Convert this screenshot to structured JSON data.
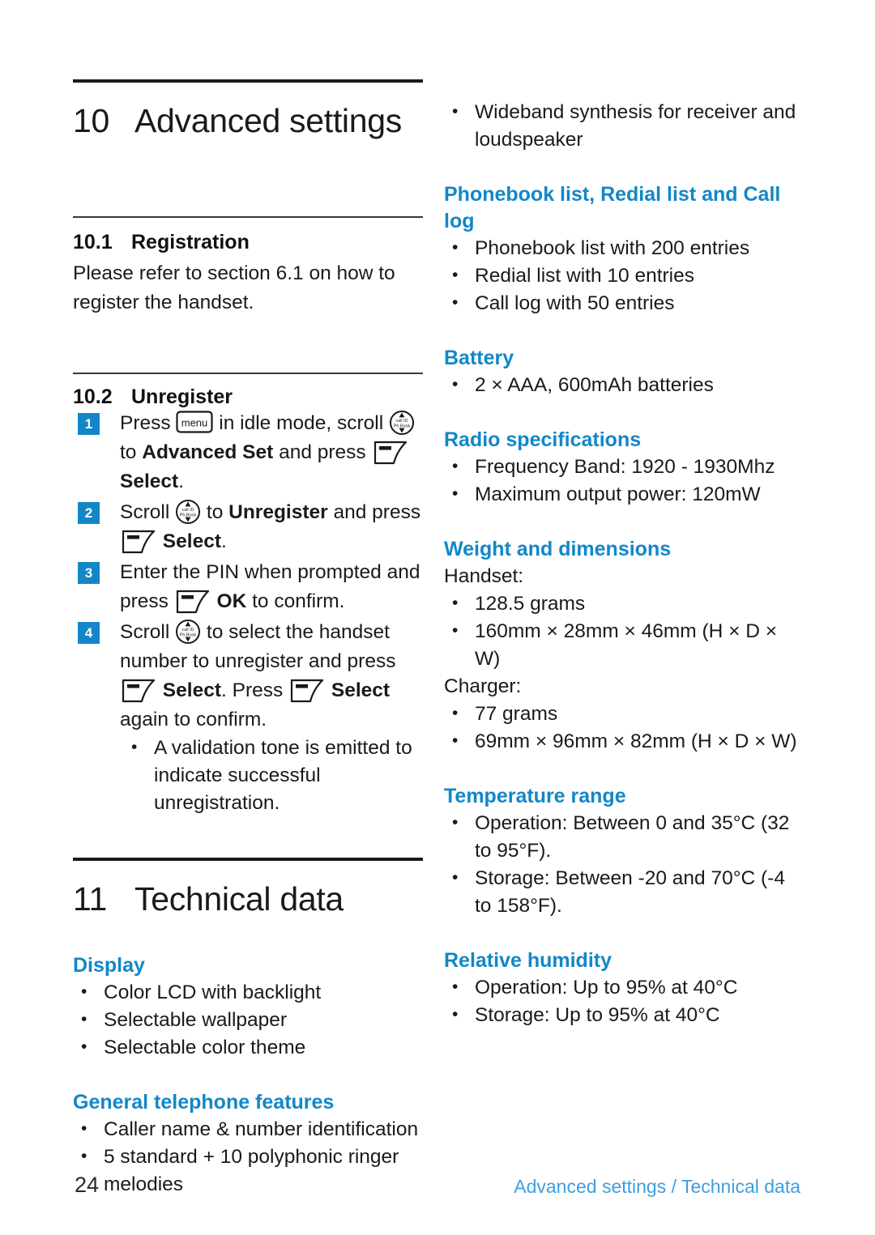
{
  "document": {
    "footer": {
      "page_number": "24",
      "running_title": "Advanced settings / Technical data"
    }
  },
  "left_column": {
    "chapter_10": {
      "number": "10",
      "title": "Advanced settings"
    },
    "section_10_1": {
      "number": "10.1",
      "title": "Registration",
      "body": "Please refer to section 6.1 on how to register the handset."
    },
    "section_10_2": {
      "number": "10.2",
      "title": "Unregister",
      "steps": [
        {
          "index": "1",
          "parts": [
            {
              "type": "text",
              "value": "Press "
            },
            {
              "type": "icon",
              "icon": "menu-key-icon",
              "label": "menu"
            },
            {
              "type": "text",
              "value": " in idle mode, scroll "
            },
            {
              "type": "icon",
              "icon": "navigation-key-icon",
              "label": "call ID / Ph.Book"
            },
            {
              "type": "text",
              "value": " to "
            },
            {
              "type": "bold",
              "value": "Advanced Set"
            },
            {
              "type": "text",
              "value": " and press "
            },
            {
              "type": "icon",
              "icon": "soft-key-icon",
              "label": "soft key"
            },
            {
              "type": "bold",
              "value": " Select"
            },
            {
              "type": "text",
              "value": "."
            }
          ]
        },
        {
          "index": "2",
          "parts": [
            {
              "type": "text",
              "value": "Scroll "
            },
            {
              "type": "icon",
              "icon": "navigation-key-icon",
              "label": "call ID / Ph.Book"
            },
            {
              "type": "text",
              "value": " to "
            },
            {
              "type": "bold",
              "value": "Unregister"
            },
            {
              "type": "text",
              "value": " and press "
            },
            {
              "type": "icon",
              "icon": "soft-key-icon",
              "label": "soft key"
            },
            {
              "type": "bold",
              "value": " Select"
            },
            {
              "type": "text",
              "value": "."
            }
          ]
        },
        {
          "index": "3",
          "parts": [
            {
              "type": "text",
              "value": "Enter the PIN when prompted and press "
            },
            {
              "type": "icon",
              "icon": "soft-key-icon",
              "label": "soft key"
            },
            {
              "type": "bold",
              "value": " OK"
            },
            {
              "type": "text",
              "value": " to confirm."
            }
          ]
        },
        {
          "index": "4",
          "parts": [
            {
              "type": "text",
              "value": "Scroll "
            },
            {
              "type": "icon",
              "icon": "navigation-key-icon",
              "label": "call ID / Ph.Book"
            },
            {
              "type": "text",
              "value": " to select the handset number to unregister and press "
            },
            {
              "type": "icon",
              "icon": "soft-key-icon",
              "label": "soft key"
            },
            {
              "type": "bold",
              "value": " Select"
            },
            {
              "type": "text",
              "value": ". Press "
            },
            {
              "type": "icon",
              "icon": "soft-key-icon",
              "label": "soft key"
            },
            {
              "type": "bold",
              "value": " Select"
            },
            {
              "type": "text",
              "value": " again to confirm."
            }
          ],
          "sub_bullets": [
            "A validation tone is emitted to indicate successful unregistration."
          ]
        }
      ]
    },
    "chapter_11": {
      "number": "11",
      "title": "Technical data"
    },
    "spec_groups": [
      {
        "heading": "Display",
        "bullets": [
          "Color LCD with backlight",
          "Selectable wallpaper",
          "Selectable color theme"
        ]
      },
      {
        "heading": "General telephone features",
        "bullets": [
          "Caller name & number identification",
          "5 standard + 10 polyphonic ringer melodies"
        ]
      }
    ]
  },
  "right_column": {
    "continued_bullets": [
      "Wideband synthesis for receiver and loudspeaker"
    ],
    "spec_groups": [
      {
        "heading": "Phonebook list, Redial list and Call log",
        "bullets": [
          "Phonebook list with 200 entries",
          "Redial list with 10 entries",
          "Call log with 50 entries"
        ]
      },
      {
        "heading": "Battery",
        "bullets": [
          "2 × AAA, 600mAh batteries"
        ]
      },
      {
        "heading": "Radio specifications",
        "bullets": [
          "Frequency Band: 1920 - 1930Mhz",
          "Maximum output power: 120mW"
        ]
      },
      {
        "heading": "Weight and dimensions",
        "subgroups": [
          {
            "label": "Handset:",
            "bullets": [
              "128.5 grams",
              "160mm × 28mm × 46mm (H × D × W)"
            ]
          },
          {
            "label": "Charger:",
            "bullets": [
              "77 grams",
              "69mm × 96mm × 82mm (H × D × W)"
            ]
          }
        ]
      },
      {
        "heading": "Temperature range",
        "bullets": [
          "Operation: Between 0 and 35°C (32 to 95°F).",
          "Storage: Between -20 and 70°C (-4 to 158°F)."
        ]
      },
      {
        "heading": "Relative humidity",
        "bullets": [
          "Operation: Up to 95% at 40°C",
          "Storage: Up to 95% at 40°C"
        ]
      }
    ]
  },
  "colors": {
    "heading_blue": "#1287c8",
    "footer_blue": "#3f9ede",
    "text_black": "#1a1a1a"
  }
}
